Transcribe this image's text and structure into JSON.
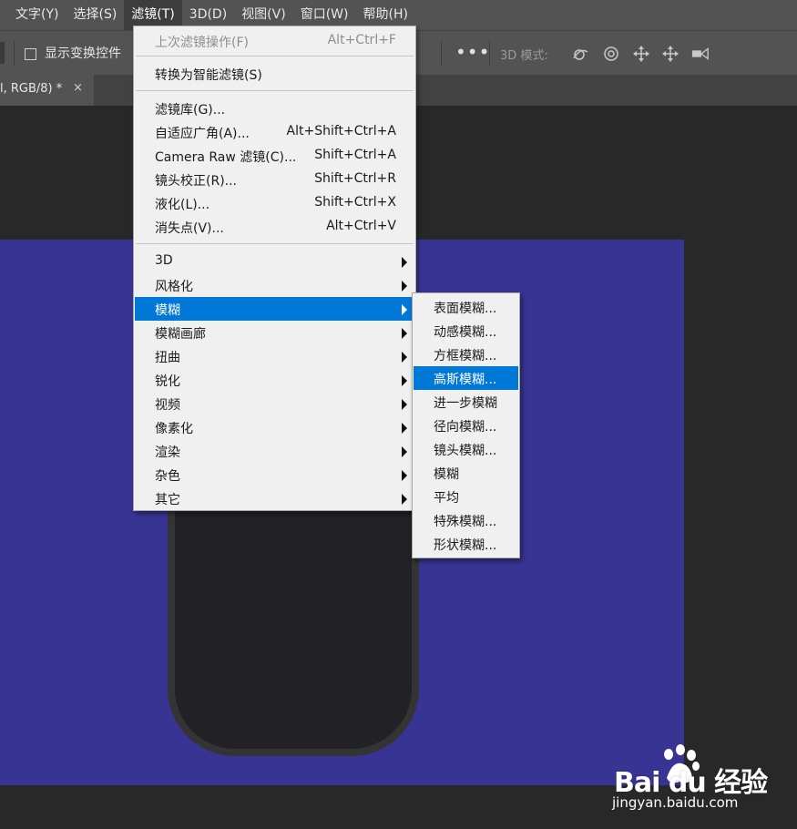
{
  "menubar": {
    "items": [
      "文字(Y)",
      "选择(S)",
      "滤镜(T)",
      "3D(D)",
      "视图(V)",
      "窗口(W)",
      "帮助(H)"
    ],
    "active_index": 2
  },
  "options_bar": {
    "show_transform_label": "显示变换控件",
    "more_label": "•••",
    "mode_3d_label": "3D 模式:"
  },
  "document_tab": {
    "title": "l, RGB/8) *",
    "close_label": "×"
  },
  "filter_menu": {
    "last_filter": {
      "label": "上次滤镜操作(F)",
      "shortcut": "Alt+Ctrl+F"
    },
    "convert_smart": {
      "label": "转换为智能滤镜(S)"
    },
    "items": [
      {
        "label": "滤镜库(G)...",
        "shortcut": ""
      },
      {
        "label": "自适应广角(A)...",
        "shortcut": "Alt+Shift+Ctrl+A"
      },
      {
        "label": "Camera Raw 滤镜(C)...",
        "shortcut": "Shift+Ctrl+A"
      },
      {
        "label": "镜头校正(R)...",
        "shortcut": "Shift+Ctrl+R"
      },
      {
        "label": "液化(L)...",
        "shortcut": "Shift+Ctrl+X"
      },
      {
        "label": "消失点(V)...",
        "shortcut": "Alt+Ctrl+V"
      }
    ],
    "groups": [
      "3D",
      "风格化",
      "模糊",
      "模糊画廊",
      "扭曲",
      "锐化",
      "视频",
      "像素化",
      "渲染",
      "杂色",
      "其它"
    ],
    "highlighted_group": "模糊"
  },
  "blur_submenu": {
    "items": [
      "表面模糊...",
      "动感模糊...",
      "方框模糊...",
      "高斯模糊...",
      "进一步模糊",
      "径向模糊...",
      "镜头模糊...",
      "模糊",
      "平均",
      "特殊模糊...",
      "形状模糊..."
    ],
    "highlighted": "高斯模糊..."
  },
  "watermark": {
    "brand_text": "Bai du 经验",
    "url": "jingyan.baidu.com"
  },
  "colors": {
    "ui_dark": "#535353",
    "canvas_blue": "#383493",
    "menu_bg": "#f0f0f0",
    "highlight": "#0078d7"
  }
}
